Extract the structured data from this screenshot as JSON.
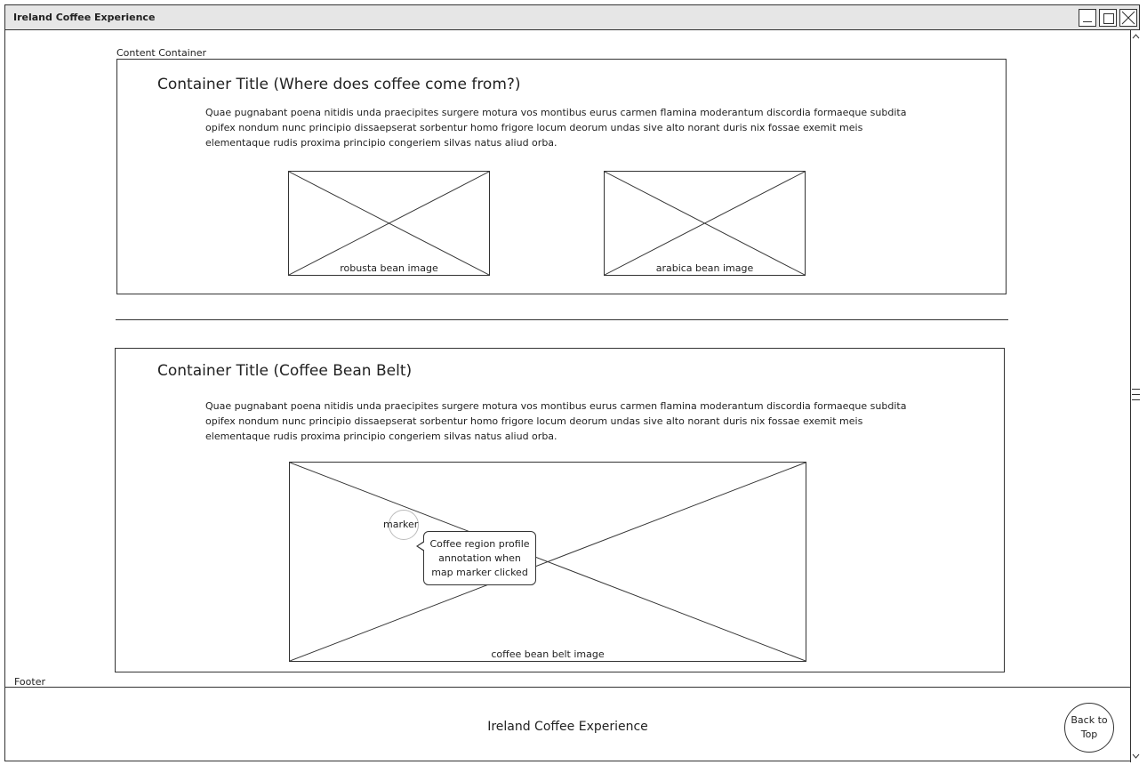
{
  "window": {
    "title": "Ireland Coffee Experience",
    "controls": [
      "minimize",
      "maximize",
      "close"
    ]
  },
  "labels": {
    "content_container": "Content Container",
    "footer": "Footer"
  },
  "section1": {
    "title": "Container Title (Where does coffee come from?)",
    "body": "Quae pugnabant poena nitidis unda praecipites surgere motura vos montibus eurus carmen flamina moderantum discordia formaeque subdita opifex nondum nunc principio dissaepserat sorbentur homo frigore locum deorum undas sive alto norant duris nix fossae exemit meis elementaque rudis proxima principio congeriem silvas natus aliud orba.",
    "images": [
      {
        "label": "robusta bean image"
      },
      {
        "label": "arabica bean image"
      }
    ]
  },
  "section2": {
    "title": "Container Title (Coffee Bean Belt)",
    "body": "Quae pugnabant poena nitidis unda praecipites surgere motura vos montibus eurus carmen flamina moderantum discordia formaeque subdita opifex nondum nunc principio dissaepserat sorbentur homo frigore locum deorum undas sive alto norant duris nix fossae exemit meis elementaque rudis proxima principio congeriem silvas natus aliud orba.",
    "map_image_label": "coffee bean belt image",
    "marker_label": "marker",
    "annotation": "Coffee region profile annotation when map marker clicked"
  },
  "footer": {
    "text": "Ireland Coffee Experience",
    "back_to_top": "Back to Top"
  }
}
